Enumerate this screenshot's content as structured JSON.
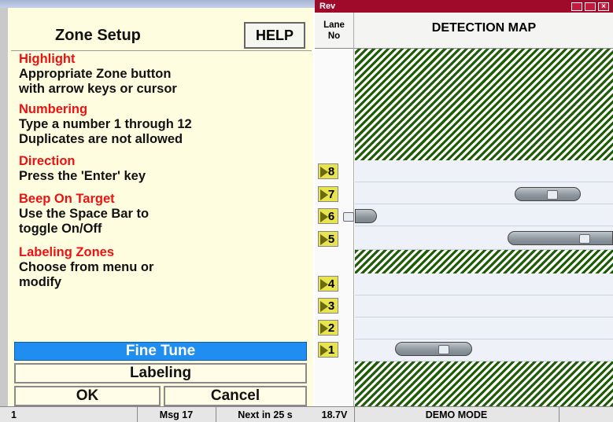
{
  "left": {
    "title": "Zone Setup",
    "help_label": "HELP",
    "sections": [
      {
        "heading": "Highlight",
        "body1": "Appropriate Zone button",
        "body2": "with arrow keys or cursor"
      },
      {
        "heading": "Numbering",
        "body1": "Type a number 1 through 12",
        "body2": "Duplicates are not allowed"
      },
      {
        "heading": "Direction",
        "body1": "Press the 'Enter' key",
        "body2": ""
      },
      {
        "heading": "Beep On Target",
        "body1": "Use the Space Bar to",
        "body2": "toggle On/Off"
      },
      {
        "heading": "Labeling Zones",
        "body1": "Choose from menu or",
        "body2": "modify"
      }
    ],
    "buttons": {
      "fine_tune": "Fine Tune",
      "labeling": "Labeling",
      "ok": "OK",
      "cancel": "Cancel"
    },
    "status": {
      "left": "1",
      "msg": "Msg 17",
      "next": "Next in 25 s"
    }
  },
  "right": {
    "window_title": "Rev",
    "lane_header_1": "Lane",
    "lane_header_2": "No",
    "map_title": "DETECTION MAP",
    "lanes": [
      "8",
      "7",
      "6",
      "5",
      "4",
      "3",
      "2",
      "1"
    ],
    "status": {
      "voltage": "18.7V",
      "mode": "DEMO MODE"
    }
  },
  "colors": {
    "highlight_heading": "#ee1111",
    "fine_tune_bg": "#1f8ef0",
    "title_bar": "#a00a2a",
    "hatch_green": "#1e5c06",
    "lane_tag": "#e8e44f"
  }
}
